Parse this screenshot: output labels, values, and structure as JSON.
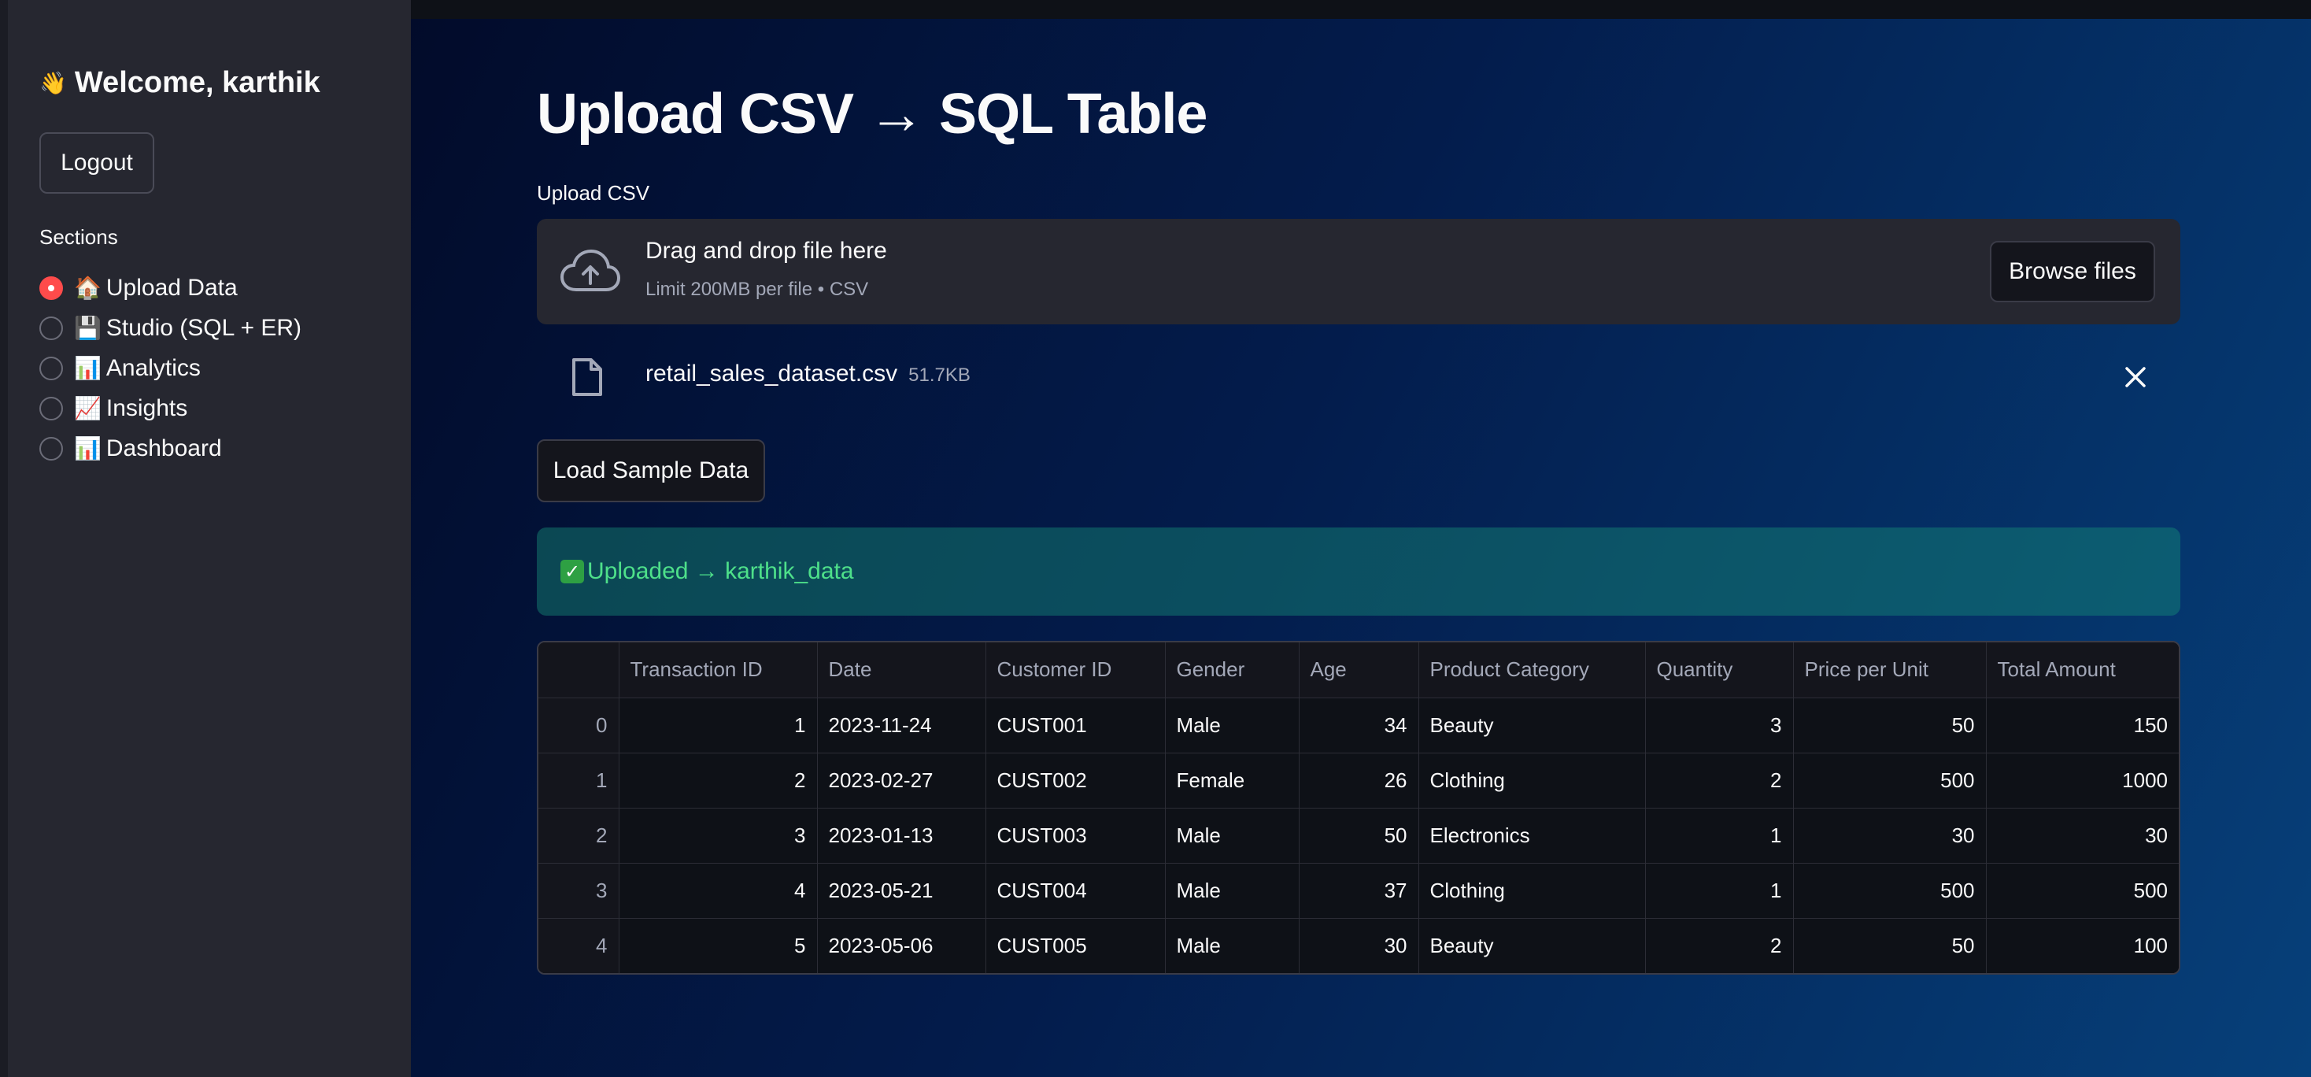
{
  "sidebar": {
    "welcome_emoji": "👋",
    "welcome_text": "Welcome, karthik",
    "logout_label": "Logout",
    "sections_label": "Sections",
    "items": [
      {
        "emoji": "🏠",
        "label": "Upload Data",
        "selected": true
      },
      {
        "emoji": "💾",
        "label": "Studio (SQL + ER)",
        "selected": false
      },
      {
        "emoji": "📊",
        "label": "Analytics",
        "selected": false
      },
      {
        "emoji": "📈",
        "label": "Insights",
        "selected": false
      },
      {
        "emoji": "📊",
        "label": "Dashboard",
        "selected": false
      }
    ]
  },
  "main": {
    "title": "Upload CSV → SQL Table",
    "upload_label": "Upload CSV",
    "dropzone": {
      "title": "Drag and drop file here",
      "subtitle": "Limit 200MB per file • CSV",
      "browse_label": "Browse files",
      "icon": "cloud-upload-icon"
    },
    "file": {
      "name": "retail_sales_dataset.csv",
      "size": "51.7KB",
      "icon": "file-icon"
    },
    "sample_button": "Load Sample Data",
    "success": {
      "text": "Uploaded → karthik_data",
      "icon": "check-mark-icon"
    },
    "table": {
      "columns": [
        "",
        "Transaction ID",
        "Date",
        "Customer ID",
        "Gender",
        "Age",
        "Product Category",
        "Quantity",
        "Price per Unit",
        "Total Amount"
      ],
      "rows": [
        [
          "0",
          "1",
          "2023-11-24",
          "CUST001",
          "Male",
          "34",
          "Beauty",
          "3",
          "50",
          "150"
        ],
        [
          "1",
          "2",
          "2023-02-27",
          "CUST002",
          "Female",
          "26",
          "Clothing",
          "2",
          "500",
          "1000"
        ],
        [
          "2",
          "3",
          "2023-01-13",
          "CUST003",
          "Male",
          "50",
          "Electronics",
          "1",
          "30",
          "30"
        ],
        [
          "3",
          "4",
          "2023-05-21",
          "CUST004",
          "Male",
          "37",
          "Clothing",
          "1",
          "500",
          "500"
        ],
        [
          "4",
          "5",
          "2023-05-06",
          "CUST005",
          "Male",
          "30",
          "Beauty",
          "2",
          "50",
          "100"
        ]
      ]
    }
  },
  "colors": {
    "accent": "#ff4b4b",
    "sidebar_bg": "#262730",
    "success_text": "#4ee08a"
  }
}
